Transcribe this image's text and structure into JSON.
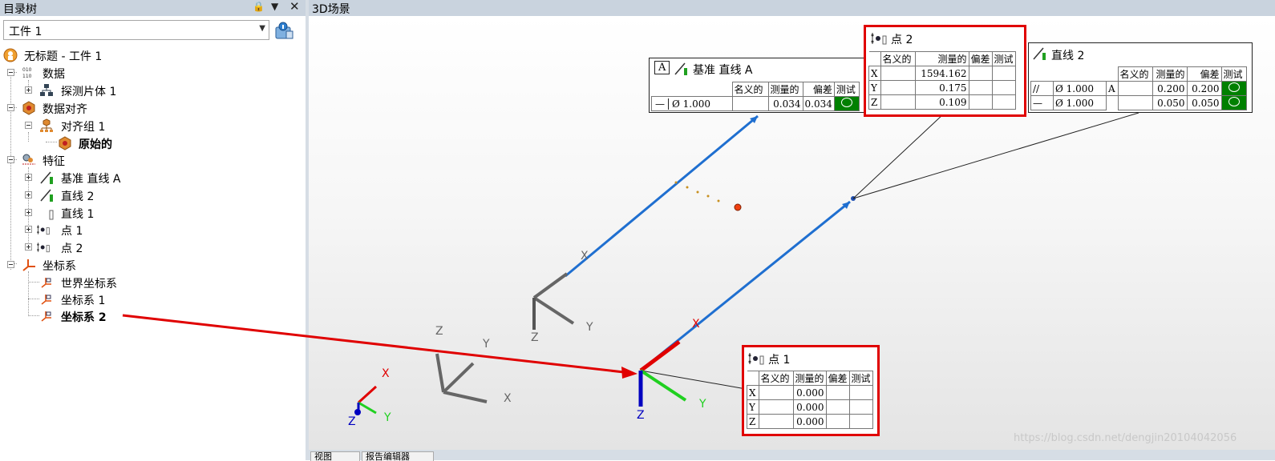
{
  "left_panel": {
    "title": "目录树",
    "workpiece_selected": "工件 1",
    "tree": [
      {
        "label": "无标题 - 工件 1",
        "icon": "workpiece-icon",
        "level": 0
      },
      {
        "label": "数据",
        "icon": "data-icon",
        "level": 1,
        "expanded": true
      },
      {
        "label": "探测片体 1",
        "icon": "probe-body-icon",
        "level": 2,
        "expandable": true
      },
      {
        "label": "数据对齐",
        "icon": "alignment-icon",
        "level": 1,
        "expanded": true
      },
      {
        "label": "对齐组 1",
        "icon": "alignment-group-icon",
        "level": 2,
        "expanded": true
      },
      {
        "label": "原始的",
        "icon": "original-alignment-icon",
        "level": 3,
        "bold": true
      },
      {
        "label": "特征",
        "icon": "features-icon",
        "level": 1,
        "expanded": true
      },
      {
        "label": "基准 直线 A",
        "icon": "datum-line-icon",
        "level": 2,
        "expandable": true
      },
      {
        "label": "直线 2",
        "icon": "line-icon",
        "level": 2,
        "expandable": true
      },
      {
        "label": "直线 1",
        "icon": "line-gray-icon",
        "level": 2,
        "expandable": true
      },
      {
        "label": "点 1",
        "icon": "point-icon",
        "level": 2,
        "expandable": true
      },
      {
        "label": "点 2",
        "icon": "point-icon",
        "level": 2,
        "expandable": true
      },
      {
        "label": "坐标系",
        "icon": "coordinate-system-icon",
        "level": 1,
        "expanded": true
      },
      {
        "label": "世界坐标系",
        "icon": "csys-icon",
        "level": 2
      },
      {
        "label": "坐标系 1",
        "icon": "csys-icon",
        "level": 2
      },
      {
        "label": "坐标系 2",
        "icon": "csys-icon",
        "level": 2,
        "bold": true
      }
    ]
  },
  "scene": {
    "title": "3D场景",
    "tabs": [
      "视图",
      "报告编辑器"
    ],
    "watermark": "https://blog.csdn.net/dengjin20104042056",
    "axis_letters": {
      "x": "X",
      "y": "Y",
      "z": "Z"
    },
    "colors": {
      "line_blue": "#1f6fd0",
      "axis_red": "#e00000",
      "axis_green": "#20d020",
      "axis_blue": "#0000c0",
      "pass_green": "#008000",
      "highlight_red": "#e00000"
    }
  },
  "label_datum": {
    "symbol": "A",
    "title": "基准 直线 A",
    "headers": [
      "名义的",
      "测量的",
      "偏差",
      "测试"
    ],
    "tol_symbol": "—",
    "tol_value": "Ø 1.000",
    "nominal": "",
    "measured": "0.034",
    "deviation": "0.034"
  },
  "label_point2": {
    "title": "点 2",
    "headers": [
      "名义的",
      "测量的",
      "偏差",
      "测试"
    ],
    "rows": [
      {
        "axis": "X",
        "nominal": "",
        "measured": "1594.162",
        "deviation": "",
        "test": ""
      },
      {
        "axis": "Y",
        "nominal": "",
        "measured": "0.175",
        "deviation": "",
        "test": ""
      },
      {
        "axis": "Z",
        "nominal": "",
        "measured": "0.109",
        "deviation": "",
        "test": ""
      }
    ]
  },
  "label_line2": {
    "title": "直线 2",
    "headers": [
      "名义的",
      "测量的",
      "偏差",
      "测试"
    ],
    "rows": [
      {
        "symbol": "//",
        "tol": "Ø 1.000",
        "datum": "A",
        "nominal": "",
        "measured": "0.200",
        "deviation": "0.200"
      },
      {
        "symbol": "—",
        "tol": "Ø 1.000",
        "datum": "",
        "nominal": "",
        "measured": "0.050",
        "deviation": "0.050"
      }
    ]
  },
  "label_point1": {
    "title": "点 1",
    "headers": [
      "名义的",
      "测量的",
      "偏差",
      "测试"
    ],
    "rows": [
      {
        "axis": "X",
        "nominal": "",
        "measured": "0.000",
        "deviation": "",
        "test": ""
      },
      {
        "axis": "Y",
        "nominal": "",
        "measured": "0.000",
        "deviation": "",
        "test": ""
      },
      {
        "axis": "Z",
        "nominal": "",
        "measured": "0.000",
        "deviation": "",
        "test": ""
      }
    ]
  }
}
